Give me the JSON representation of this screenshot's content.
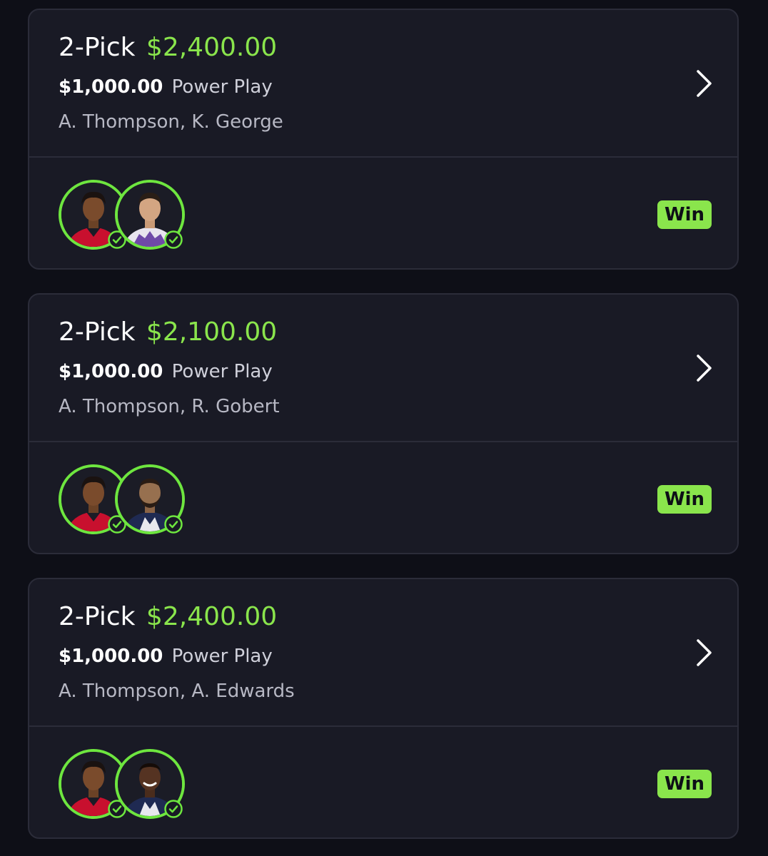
{
  "colors": {
    "background": "#0e0f17",
    "card": "#191a25",
    "accent_green": "#8ae54c",
    "avatar_ring": "#6ee63f"
  },
  "entries": [
    {
      "pick_label": "2-Pick",
      "payout": "$2,400.00",
      "entry_amount": "$1,000.00",
      "entry_type": "Power Play",
      "players": "A. Thompson, K. George",
      "result": "Win",
      "avatars": [
        "player-thompson-avatar",
        "player-george-avatar"
      ]
    },
    {
      "pick_label": "2-Pick",
      "payout": "$2,100.00",
      "entry_amount": "$1,000.00",
      "entry_type": "Power Play",
      "players": "A. Thompson, R. Gobert",
      "result": "Win",
      "avatars": [
        "player-thompson-avatar",
        "player-gobert-avatar"
      ]
    },
    {
      "pick_label": "2-Pick",
      "payout": "$2,400.00",
      "entry_amount": "$1,000.00",
      "entry_type": "Power Play",
      "players": "A. Thompson, A. Edwards",
      "result": "Win",
      "avatars": [
        "player-thompson-avatar",
        "player-edwards-avatar"
      ]
    }
  ],
  "icons": {
    "chevron": "chevron-right-icon",
    "check": "check-circle-icon"
  }
}
